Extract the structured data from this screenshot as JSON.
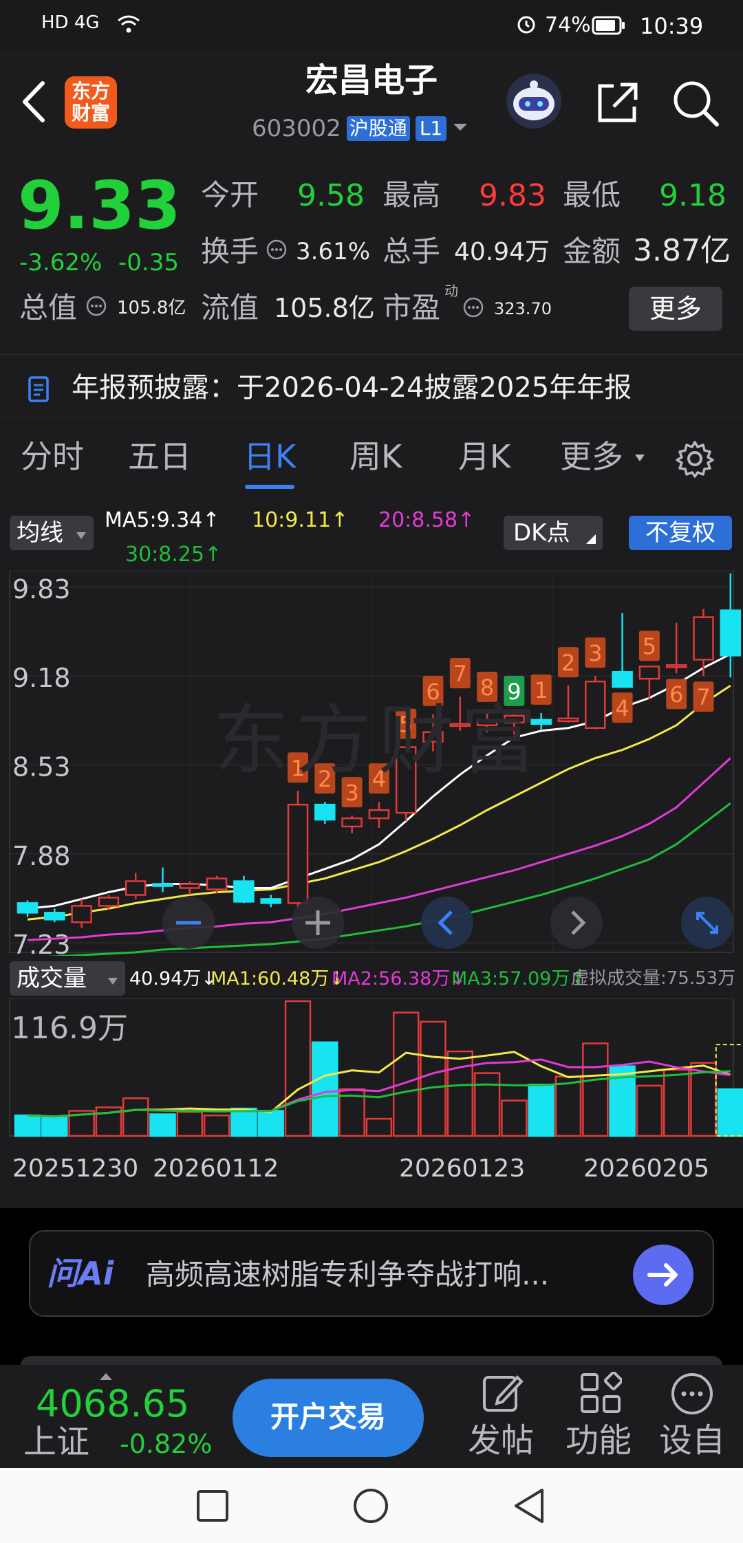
{
  "status_bar": {
    "network": "HD 4G",
    "battery": "74%",
    "time": "10:39"
  },
  "header": {
    "logo_line1": "东方",
    "logo_line2": "财富",
    "title": "宏昌电子",
    "code": "603002",
    "tag_hgt": "沪股通",
    "tag_level": "L1"
  },
  "quote": {
    "price": "9.33",
    "change_pct": "-3.62%",
    "change": "-0.35",
    "open_label": "今开",
    "open": "9.58",
    "high_label": "最高",
    "high": "9.83",
    "low_label": "最低",
    "low": "9.18",
    "turnover_label": "换手",
    "turnover": "3.61%",
    "volume_label": "总手",
    "volume": "40.94万",
    "amount_label": "金额",
    "amount": "3.87亿",
    "total_cap_label": "总值",
    "total_cap": "105.8亿",
    "float_cap_label": "流值",
    "float_cap": "105.8亿",
    "pe_label": "市盈",
    "pe_sup": "动",
    "pe": "323.70",
    "more_label": "更多"
  },
  "notice": {
    "text": "年报预披露：于2026-04-24披露2025年年报"
  },
  "tabs": {
    "items": [
      "分时",
      "五日",
      "日K",
      "周K",
      "月K",
      "更多"
    ],
    "active": "日K"
  },
  "ma_row": {
    "selector": "均线",
    "ma5": "MA5:9.34↑",
    "ma10": "10:9.11↑",
    "ma20": "20:8.58↑",
    "ma30": "30:8.25↑",
    "dk": "DK点",
    "fq": "不复权"
  },
  "vol_row": {
    "selector": "成交量",
    "vol": "40.94万↓",
    "ma1": "MA1:60.48万↓",
    "ma2": "MA2:56.38万↓",
    "ma3": "MA3:57.09万↑",
    "virtual": "虚拟成交量:75.53万"
  },
  "colors": {
    "up": "#e23a3a",
    "down": "#18e3f0",
    "ma5": "#ffffff",
    "ma10": "#f5e94a",
    "ma20": "#e23ad8",
    "ma30": "#1fbe3a",
    "accent": "#3b82f6",
    "green_text": "#22d13a",
    "red_text": "#ff3b3b"
  },
  "chart_data": {
    "type": "candlestick",
    "y_ticks": [
      "9.83",
      "9.18",
      "8.53",
      "7.88",
      "7.23"
    ],
    "candles": [
      {
        "o": 7.52,
        "h": 7.54,
        "l": 7.42,
        "c": 7.45
      },
      {
        "o": 7.45,
        "h": 7.48,
        "l": 7.38,
        "c": 7.4
      },
      {
        "o": 7.38,
        "h": 7.55,
        "l": 7.34,
        "c": 7.5
      },
      {
        "o": 7.5,
        "h": 7.58,
        "l": 7.47,
        "c": 7.56
      },
      {
        "o": 7.58,
        "h": 7.74,
        "l": 7.55,
        "c": 7.68
      },
      {
        "o": 7.66,
        "h": 7.78,
        "l": 7.6,
        "c": 7.65
      },
      {
        "o": 7.63,
        "h": 7.68,
        "l": 7.58,
        "c": 7.66
      },
      {
        "o": 7.62,
        "h": 7.72,
        "l": 7.59,
        "c": 7.7
      },
      {
        "o": 7.68,
        "h": 7.72,
        "l": 7.52,
        "c": 7.53
      },
      {
        "o": 7.55,
        "h": 7.58,
        "l": 7.49,
        "c": 7.52
      },
      {
        "o": 7.52,
        "h": 8.34,
        "l": 7.48,
        "c": 8.24
      },
      {
        "o": 8.24,
        "h": 8.26,
        "l": 8.1,
        "c": 8.13
      },
      {
        "o": 8.08,
        "h": 8.16,
        "l": 8.03,
        "c": 8.14
      },
      {
        "o": 8.14,
        "h": 8.26,
        "l": 8.07,
        "c": 8.2
      },
      {
        "o": 8.18,
        "h": 8.66,
        "l": 8.12,
        "c": 8.66
      },
      {
        "o": 8.7,
        "h": 8.9,
        "l": 8.63,
        "c": 8.77
      },
      {
        "o": 8.82,
        "h": 9.03,
        "l": 8.78,
        "c": 8.83
      },
      {
        "o": 8.82,
        "h": 8.93,
        "l": 8.77,
        "c": 8.86
      },
      {
        "o": 8.84,
        "h": 8.9,
        "l": 8.75,
        "c": 8.89
      },
      {
        "o": 8.86,
        "h": 8.91,
        "l": 8.79,
        "c": 8.83
      },
      {
        "o": 8.85,
        "h": 9.11,
        "l": 8.84,
        "c": 8.87
      },
      {
        "o": 8.8,
        "h": 9.18,
        "l": 8.79,
        "c": 9.14
      },
      {
        "o": 9.21,
        "h": 9.64,
        "l": 9.1,
        "c": 9.1
      },
      {
        "o": 9.16,
        "h": 9.23,
        "l": 9.01,
        "c": 9.25
      },
      {
        "o": 9.25,
        "h": 9.57,
        "l": 9.2,
        "c": 9.26
      },
      {
        "o": 9.3,
        "h": 9.67,
        "l": 9.18,
        "c": 9.61
      },
      {
        "o": 9.66,
        "h": 9.93,
        "l": 9.17,
        "c": 9.33
      }
    ],
    "ma5": [
      7.48,
      7.5,
      7.55,
      7.6,
      7.64,
      7.66,
      7.66,
      7.65,
      7.63,
      7.63,
      7.7,
      7.77,
      7.84,
      7.95,
      8.12,
      8.3,
      8.46,
      8.6,
      8.73,
      8.78,
      8.8,
      8.85,
      8.95,
      9.02,
      9.12,
      9.24,
      9.34
    ],
    "ma10": [
      7.4,
      7.42,
      7.45,
      7.48,
      7.52,
      7.55,
      7.58,
      7.6,
      7.61,
      7.62,
      7.66,
      7.7,
      7.76,
      7.82,
      7.9,
      7.99,
      8.09,
      8.2,
      8.3,
      8.4,
      8.5,
      8.58,
      8.64,
      8.72,
      8.82,
      8.98,
      9.11
    ],
    "ma20": [
      7.25,
      7.26,
      7.27,
      7.29,
      7.3,
      7.32,
      7.34,
      7.35,
      7.37,
      7.38,
      7.41,
      7.44,
      7.48,
      7.52,
      7.56,
      7.61,
      7.66,
      7.71,
      7.76,
      7.82,
      7.88,
      7.94,
      8.01,
      8.1,
      8.22,
      8.4,
      8.58
    ],
    "ma30": [
      7.12,
      7.13,
      7.14,
      7.15,
      7.16,
      7.18,
      7.19,
      7.2,
      7.21,
      7.22,
      7.24,
      7.26,
      7.29,
      7.32,
      7.35,
      7.39,
      7.43,
      7.48,
      7.53,
      7.58,
      7.64,
      7.7,
      7.77,
      7.84,
      7.95,
      8.1,
      8.25
    ],
    "signals": [
      {
        "i": 10,
        "t": "1",
        "pos": "above"
      },
      {
        "i": 11,
        "t": "2",
        "pos": "above"
      },
      {
        "i": 12,
        "t": "3",
        "pos": "above"
      },
      {
        "i": 13,
        "t": "4",
        "pos": "above"
      },
      {
        "i": 14,
        "t": "5",
        "pos": "above"
      },
      {
        "i": 15,
        "t": "6",
        "pos": "above"
      },
      {
        "i": 16,
        "t": "7",
        "pos": "above"
      },
      {
        "i": 17,
        "t": "8",
        "pos": "above"
      },
      {
        "i": 18,
        "t": "9",
        "pos": "above",
        "green": true
      },
      {
        "i": 19,
        "t": "1",
        "pos": "above"
      },
      {
        "i": 20,
        "t": "2",
        "pos": "above"
      },
      {
        "i": 21,
        "t": "3",
        "pos": "above"
      },
      {
        "i": 22,
        "t": "4",
        "pos": "below"
      },
      {
        "i": 23,
        "t": "5",
        "pos": "above"
      },
      {
        "i": 24,
        "t": "6",
        "pos": "below"
      },
      {
        "i": 25,
        "t": "7",
        "pos": "below"
      }
    ],
    "volume": [
      18,
      16,
      22,
      25,
      33,
      19,
      21,
      18,
      24,
      22,
      118,
      82,
      41,
      15,
      108,
      100,
      74,
      55,
      31,
      45,
      52,
      81,
      61,
      44,
      58,
      64,
      40.94
    ],
    "vol_ylabel": "116.9万",
    "x_labels": [
      "20251230",
      "20260112",
      "20260123",
      "20260205"
    ]
  },
  "ai_bar": {
    "logo": "问Ai",
    "text": "高频高速树脂专利争夺战打响..."
  },
  "bottom": {
    "index_value": "4068.65",
    "index_name": "上证",
    "index_change": "-0.82%",
    "trade_btn": "开户交易",
    "post": "发帖",
    "func": "功能",
    "custom": "设自"
  }
}
